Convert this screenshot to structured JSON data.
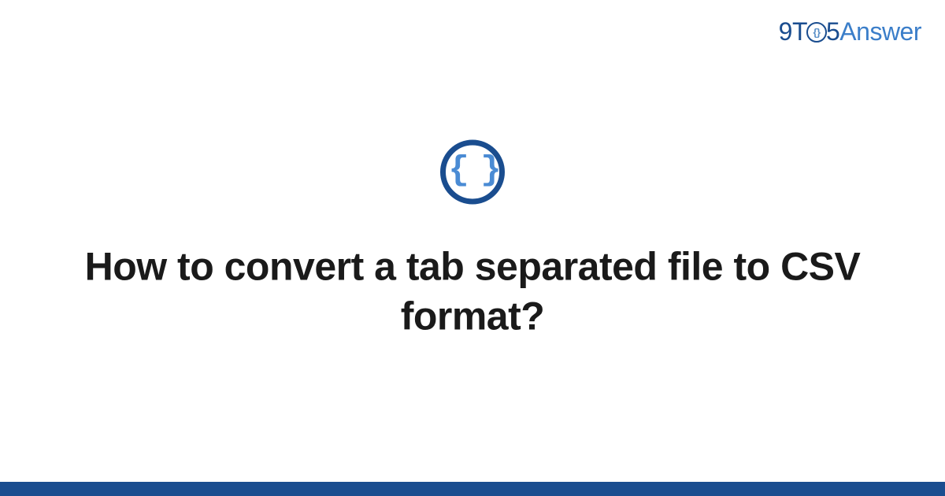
{
  "logo": {
    "part1": "9T",
    "part_o_inner": "{}",
    "part2": "5",
    "part3": "Answer"
  },
  "icon": {
    "braces": "{ }"
  },
  "title": "How to convert a tab separated file to CSV format?"
}
